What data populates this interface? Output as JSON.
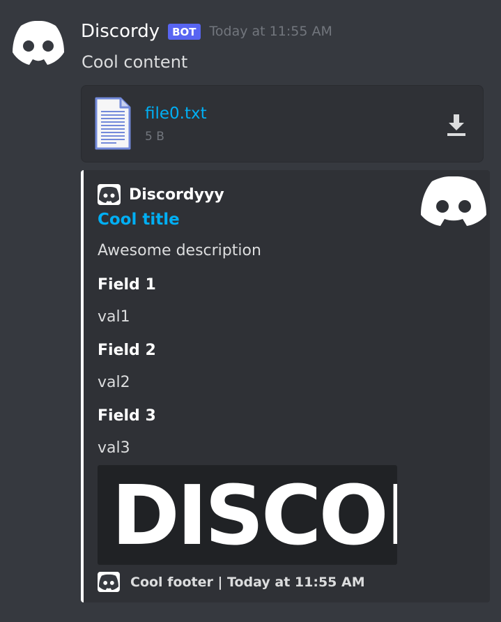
{
  "message": {
    "author": "Discordy",
    "badge": "BOT",
    "timestamp": "Today at 11:55 AM",
    "content": "Cool content",
    "avatar_icon": "discord-logo-icon"
  },
  "attachment": {
    "file_name": "file0.txt",
    "file_size": "5 B",
    "file_icon": "text-file-icon",
    "download_icon": "download-icon"
  },
  "embed": {
    "color": "#ffffff",
    "author": "Discordyyy",
    "title": "Cool title",
    "description": "Awesome description",
    "fields": [
      {
        "name": "Field 1",
        "value": "val1"
      },
      {
        "name": "Field 2",
        "value": "val2"
      },
      {
        "name": "Field 3",
        "value": "val3"
      }
    ],
    "image_text": "DISCOR",
    "footer": "Cool footer | Today at 11:55 AM"
  },
  "colors": {
    "background": "#36393f",
    "embed_background": "#2f3136",
    "link": "#00aff4",
    "badge": "#5865f2",
    "muted": "#72767d"
  }
}
